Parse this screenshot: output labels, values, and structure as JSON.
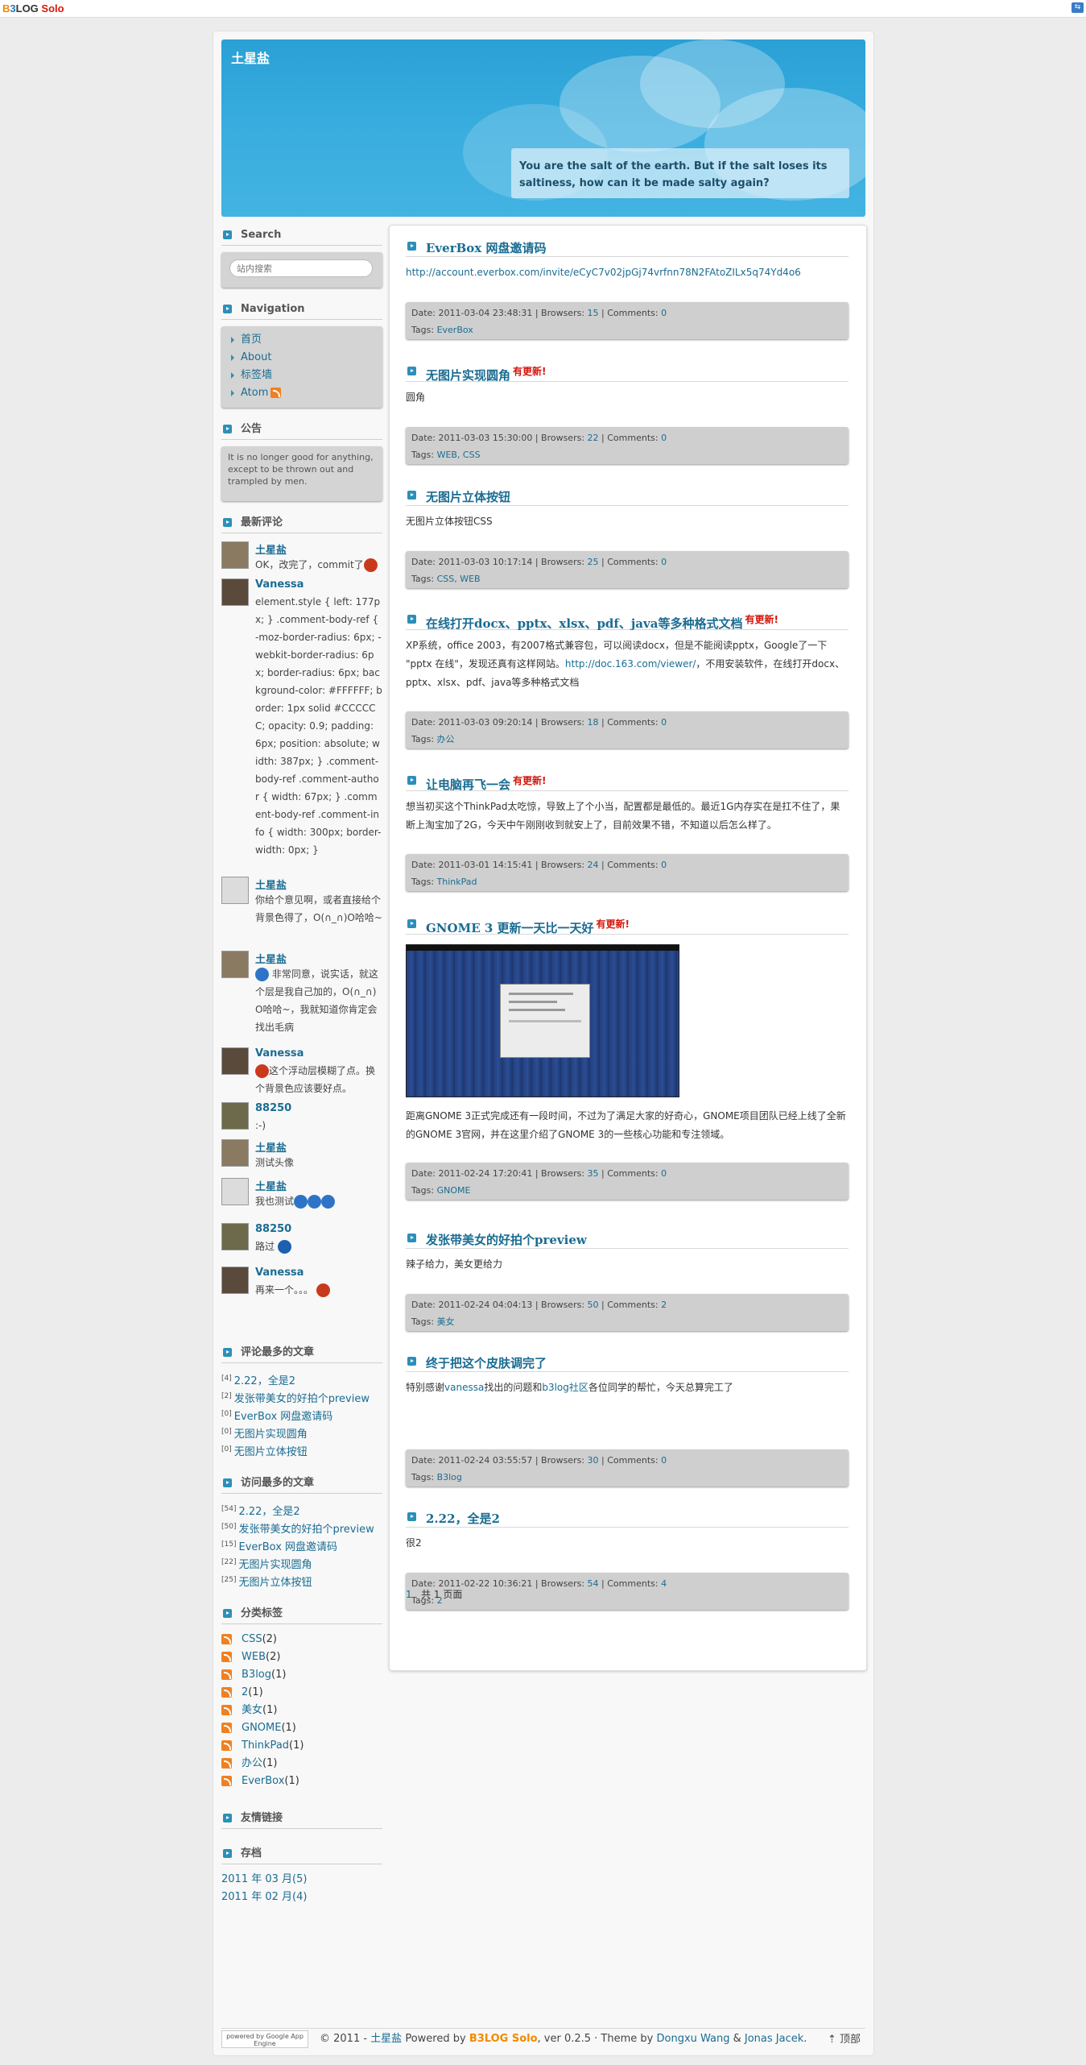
{
  "brand": {
    "b1": "B",
    "b2": "3",
    "b3": "LOG ",
    "b4": "Solo"
  },
  "header": {
    "title": "土星盐",
    "motto": "You are the salt of the earth. But if the salt loses its saltiness, how can it be made salty again?"
  },
  "sidebar": {
    "search": {
      "title": "Search",
      "placeholder": "站内搜索"
    },
    "navigation": {
      "title": "Navigation",
      "items": [
        "首页",
        "About",
        "标签墙",
        "Atom"
      ]
    },
    "notice": {
      "title": "公告",
      "text": "It is no longer good for anything, except to be thrown out and trampled by men."
    },
    "recent_comments": {
      "title": "最新评论",
      "items": [
        {
          "author": "土星盐",
          "text": "OK，改完了，commit了"
        },
        {
          "author": "Vanessa",
          "text": "element.style { left: 177px; } .comment-body-ref { -moz-border-radius: 6px; -webkit-border-radius: 6px; border-radius: 6px; background-color: #FFFFFF; border: 1px solid #CCCCCC; opacity: 0.9; padding: 6px; position: absolute; width: 387px; } .comment-body-ref .comment-author { width: 67px; } .comment-body-ref .comment-info { width: 300px; border-width: 0px; }"
        },
        {
          "author": "土星盐",
          "text": "你给个意见啊，或者直接给个背景色得了，O(∩_∩)O哈哈~"
        },
        {
          "author": "土星盐",
          "text": "非常同意，说实话，就这个层是我自己加的，O(∩_∩)O哈哈~，我就知道你肯定会找出毛病"
        },
        {
          "author": "Vanessa",
          "text": "这个浮动层模糊了点。换个背景色应该要好点。"
        },
        {
          "author": "88250",
          "text": ":-)"
        },
        {
          "author": "土星盐",
          "text": "测试头像"
        },
        {
          "author": "土星盐",
          "text": "我也测试"
        },
        {
          "author": "88250",
          "text": "路过"
        },
        {
          "author": "Vanessa",
          "text": "再来一个。。。"
        }
      ]
    },
    "most_comment": {
      "title": "评论最多的文章",
      "items": [
        {
          "count": "[4]",
          "title": "2.22，全是2"
        },
        {
          "count": "[2]",
          "title": "发张带美女的好拍个preview"
        },
        {
          "count": "[0]",
          "title": "EverBox 网盘邀请码"
        },
        {
          "count": "[0]",
          "title": "无图片实现圆角"
        },
        {
          "count": "[0]",
          "title": "无图片立体按钮"
        }
      ]
    },
    "most_view": {
      "title": "访问最多的文章",
      "items": [
        {
          "count": "[54]",
          "title": "2.22，全是2"
        },
        {
          "count": "[50]",
          "title": "发张带美女的好拍个preview"
        },
        {
          "count": "[15]",
          "title": "EverBox 网盘邀请码"
        },
        {
          "count": "[22]",
          "title": "无图片实现圆角"
        },
        {
          "count": "[25]",
          "title": "无图片立体按钮"
        }
      ]
    },
    "tags": {
      "title": "分类标签",
      "items": [
        {
          "name": "CSS",
          "count": "(2)"
        },
        {
          "name": "WEB",
          "count": "(2)"
        },
        {
          "name": "B3log",
          "count": "(1)"
        },
        {
          "name": "2",
          "count": "(1)"
        },
        {
          "name": "美女",
          "count": "(1)"
        },
        {
          "name": "GNOME",
          "count": "(1)"
        },
        {
          "name": "ThinkPad",
          "count": "(1)"
        },
        {
          "name": "办公",
          "count": "(1)"
        },
        {
          "name": "EverBox",
          "count": "(1)"
        }
      ]
    },
    "links": {
      "title": "友情链接"
    },
    "archive": {
      "title": "存档",
      "items": [
        {
          "label": "2011 年 03 月",
          "count": "(5)"
        },
        {
          "label": "2011 年 02 月",
          "count": "(4)"
        }
      ]
    }
  },
  "articles": [
    {
      "title": "EverBox 网盘邀请码",
      "new": "",
      "body": "http://account.everbox.com/invite/eCyC7v02jpGj74vrfnn78N2FAtoZILx5q74Yd4o6",
      "date": "2011-03-04 23:48:31",
      "views": "15",
      "comments": "0",
      "tags": "EverBox"
    },
    {
      "title": "无图片实现圆角",
      "new": "有更新!",
      "body": "圆角",
      "date": "2011-03-03 15:30:00",
      "views": "22",
      "comments": "0",
      "tags": "WEB, CSS"
    },
    {
      "title": "无图片立体按钮",
      "new": "",
      "body": "无图片立体按钮CSS",
      "date": "2011-03-03 10:17:14",
      "views": "25",
      "comments": "0",
      "tags": "CSS, WEB"
    },
    {
      "title": "在线打开docx、pptx、xlsx、pdf、java等多种格式文档",
      "new": "有更新!",
      "body_a": "XP系统，office 2003，有2007格式兼容包，可以阅读docx，但是不能阅读pptx，Google了一下 \"pptx 在线\"，发现还真有这样网站。",
      "body_link": "http://doc.163.com/viewer/",
      "body_b": "，不用安装软件，在线打开docx、pptx、xlsx、pdf、java等多种格式文档",
      "date": "2011-03-03 09:20:14",
      "views": "18",
      "comments": "0",
      "tags": "办公"
    },
    {
      "title": "让电脑再飞一会",
      "new": "有更新!",
      "body": "想当初买这个ThinkPad太吃惊，导致上了个小当，配置都是最低的。最近1G内存实在是扛不住了，果断上淘宝加了2G，今天中午刚刚收到就安上了，目前效果不错，不知道以后怎么样了。",
      "date": "2011-03-01 14:15:41",
      "views": "24",
      "comments": "0",
      "tags": "ThinkPad"
    },
    {
      "title": "GNOME 3 更新一天比一天好",
      "new": "有更新!",
      "body": "距离GNOME 3正式完成还有一段时间，不过为了满足大家的好奇心，GNOME项目团队已经上线了全新的GNOME 3官网，并在这里介绍了GNOME 3的一些核心功能和专注领域。",
      "date": "2011-02-24 17:20:41",
      "views": "35",
      "comments": "0",
      "tags": "GNOME"
    },
    {
      "title": "发张带美女的好拍个preview",
      "new": "",
      "body": "辣子给力，美女更给力",
      "date": "2011-02-24 04:04:13",
      "views": "50",
      "comments": "2",
      "tags": "美女"
    },
    {
      "title": "终于把这个皮肤调完了",
      "new": "",
      "body_a": "特别感谢",
      "link1": "vanessa",
      "body_b": "找出的问题和",
      "link2": "b3log社区",
      "body_c": "各位同学的帮忙，今天总算完工了",
      "date": "2011-02-24 03:55:57",
      "views": "30",
      "comments": "0",
      "tags": "B3log"
    },
    {
      "title": "2.22，全是2",
      "new": "",
      "body": "很2",
      "date": "2011-02-22 10:36:21",
      "views": "54",
      "comments": "4",
      "tags": "2"
    }
  ],
  "meta_labels": {
    "date": "Date: ",
    "views": " | Browsers: ",
    "comments": " | Comments: ",
    "tags": "Tags: "
  },
  "pager": {
    "current": "1",
    "total": "共 1 页面"
  },
  "footer": {
    "gae": "powered by Google App Engine",
    "copy": "© 2011 - ",
    "site": "土星盐",
    "powered": " Powered by ",
    "b3": "B3LOG Solo",
    "ver": ", ver 0.2.5 · Theme by ",
    "a1": "Dongxu Wang",
    "amp": " & ",
    "a2": "Jonas Jacek",
    "end": ".",
    "top": "顶部"
  }
}
